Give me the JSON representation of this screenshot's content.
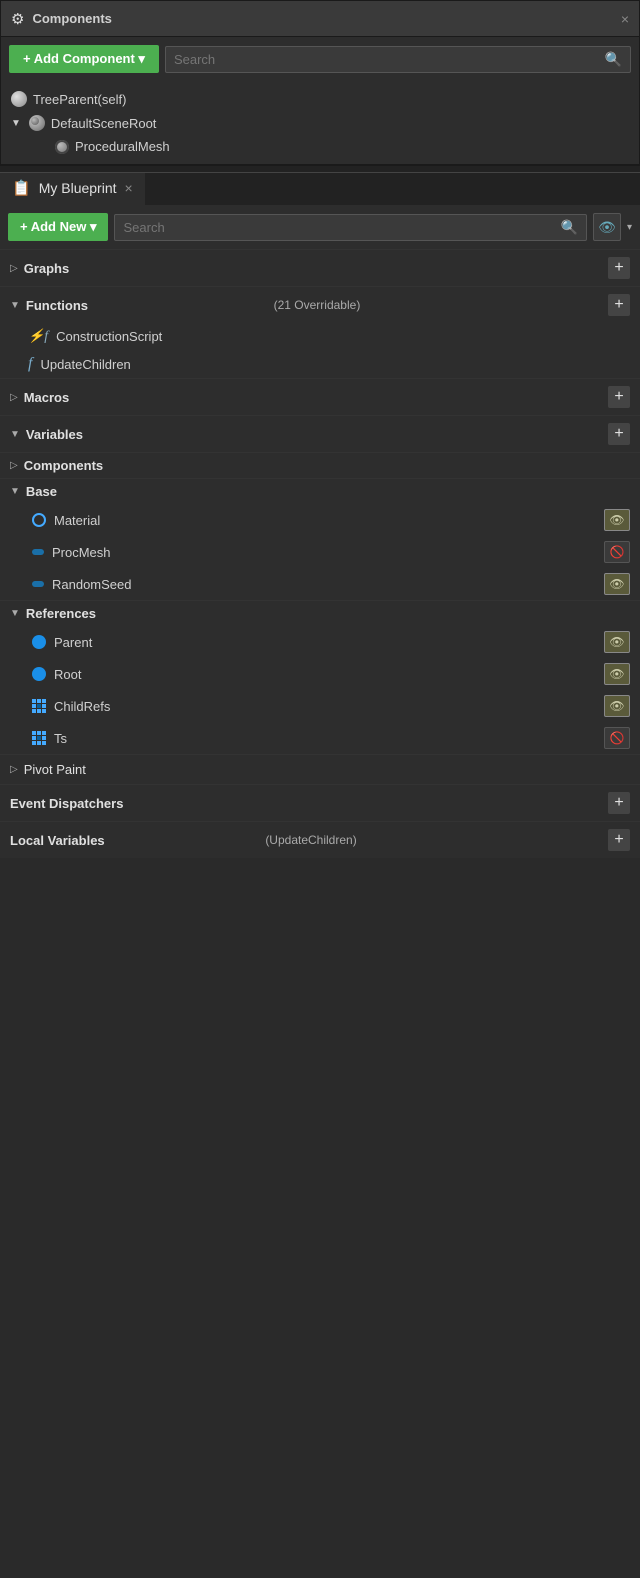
{
  "components_panel": {
    "title": "Components",
    "close": "×",
    "add_button": "+ Add Component ▾",
    "search_placeholder": "Search",
    "search_icon": "🔍",
    "tree": [
      {
        "level": 0,
        "icon": "sphere",
        "label": "TreeParent(self)",
        "arrow": null
      },
      {
        "level": 0,
        "icon": "sphere_small",
        "label": "DefaultSceneRoot",
        "arrow": "▼"
      },
      {
        "level": 1,
        "icon": "proc",
        "label": "ProceduralMesh",
        "arrow": null
      }
    ]
  },
  "my_blueprint_panel": {
    "title": "My Blueprint",
    "close": "×",
    "add_button": "+ Add New ▾",
    "search_placeholder": "Search",
    "search_icon": "🔍",
    "eye_button": "👁",
    "sections": {
      "graphs": {
        "title": "Graphs",
        "arrow": "▷",
        "plus": "+",
        "expanded": false
      },
      "functions": {
        "title": "Functions",
        "sub": "(21 Overridable)",
        "arrow": "▼",
        "plus": "+",
        "expanded": true
      },
      "macros": {
        "title": "Macros",
        "arrow": "▷",
        "plus": "+",
        "expanded": false
      },
      "variables": {
        "title": "Variables",
        "arrow": "▼",
        "plus": "+",
        "expanded": true
      },
      "event_dispatchers": {
        "title": "Event Dispatchers",
        "arrow": null,
        "plus": "+"
      },
      "local_variables": {
        "title": "Local Variables",
        "sub": "(UpdateChildren)",
        "arrow": null,
        "plus": "+"
      }
    },
    "functions_list": [
      {
        "label": "ConstructionScript",
        "icon": "construction"
      },
      {
        "label": "UpdateChildren",
        "icon": "function"
      }
    ],
    "variables": {
      "components_group": {
        "label": "Components",
        "arrow": "▷"
      },
      "base_group": {
        "label": "Base",
        "arrow": "▼",
        "items": [
          {
            "label": "Material",
            "dot": "outline-blue",
            "visible": true
          },
          {
            "label": "ProcMesh",
            "dot": "solid-blue",
            "visible": false
          },
          {
            "label": "RandomSeed",
            "dot": "solid-blue",
            "visible": true
          }
        ]
      },
      "references_group": {
        "label": "References",
        "arrow": "▼",
        "items": [
          {
            "label": "Parent",
            "dot": "solid-blue-bright",
            "visible": true
          },
          {
            "label": "Root",
            "dot": "solid-blue-bright",
            "visible": true
          },
          {
            "label": "ChildRefs",
            "dot": "grid-blue",
            "visible": true
          },
          {
            "label": "Ts",
            "dot": "grid-blue",
            "visible": false
          }
        ]
      },
      "pivot_paint": {
        "label": "Pivot Paint",
        "arrow": "▷"
      }
    }
  }
}
